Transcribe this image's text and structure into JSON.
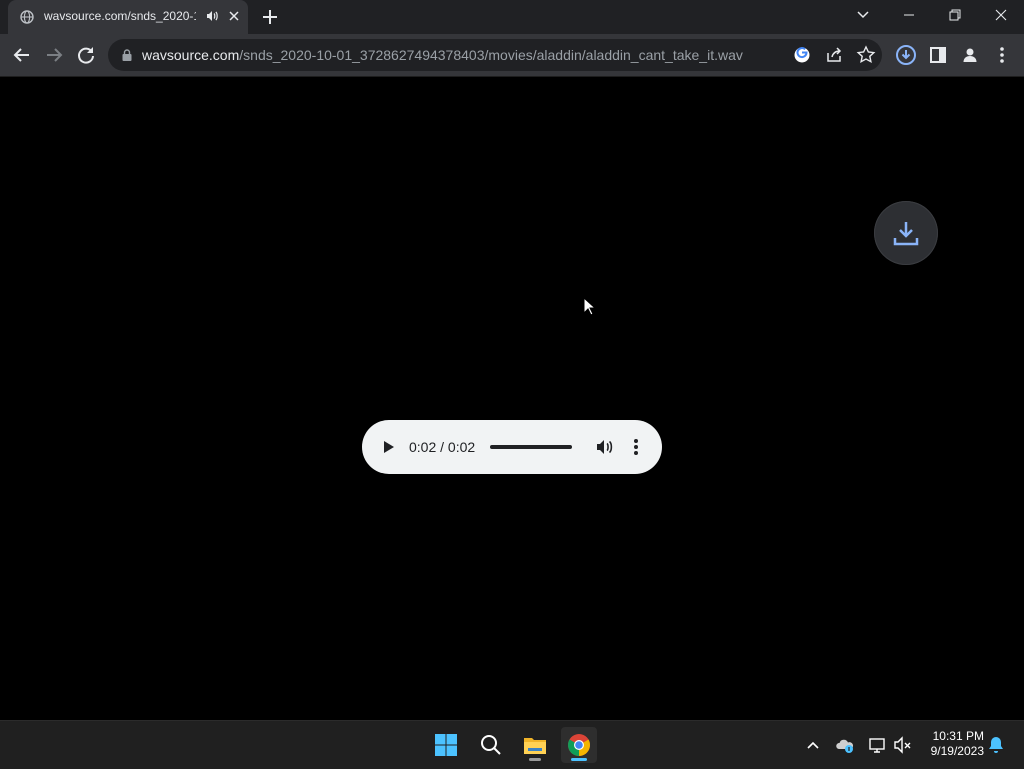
{
  "browser": {
    "tab": {
      "title": "wavsource.com/snds_2020-1",
      "favicon": "globe-icon",
      "audio_icon": "speaker-icon"
    },
    "address_bar": {
      "host": "wavsource.com",
      "path": "/snds_2020-10-01_3728627494378403/movies/aladdin/aladdin_cant_take_it.wav"
    },
    "toolbar_icons": [
      "back-icon",
      "forward-icon",
      "reload-icon",
      "lock-icon",
      "google-lens-icon",
      "share-icon",
      "star-icon",
      "download-icon",
      "side-panel-icon",
      "profile-icon",
      "menu-icon"
    ],
    "window_controls": [
      "tab-search-icon",
      "minimize-icon",
      "restore-icon",
      "close-icon"
    ]
  },
  "page": {
    "audio_player": {
      "time": "0:02 / 0:02",
      "progress": 1.0
    },
    "download_button_icon": "download-icon"
  },
  "taskbar": {
    "apps": [
      "windows-start-icon",
      "search-icon",
      "file-explorer-icon",
      "chrome-icon"
    ],
    "tray_icons": [
      "chevron-up-icon",
      "onedrive-icon",
      "network-icon",
      "volume-muted-icon",
      "bell-icon"
    ],
    "time": "10:31 PM",
    "date": "9/19/2023"
  },
  "colors": {
    "titlebar": "#202124",
    "toolbar": "#35363a",
    "page_background": "#000000",
    "player_background": "#f1f3f4",
    "accent": "#8ab4f8",
    "taskbar": "#202020"
  }
}
